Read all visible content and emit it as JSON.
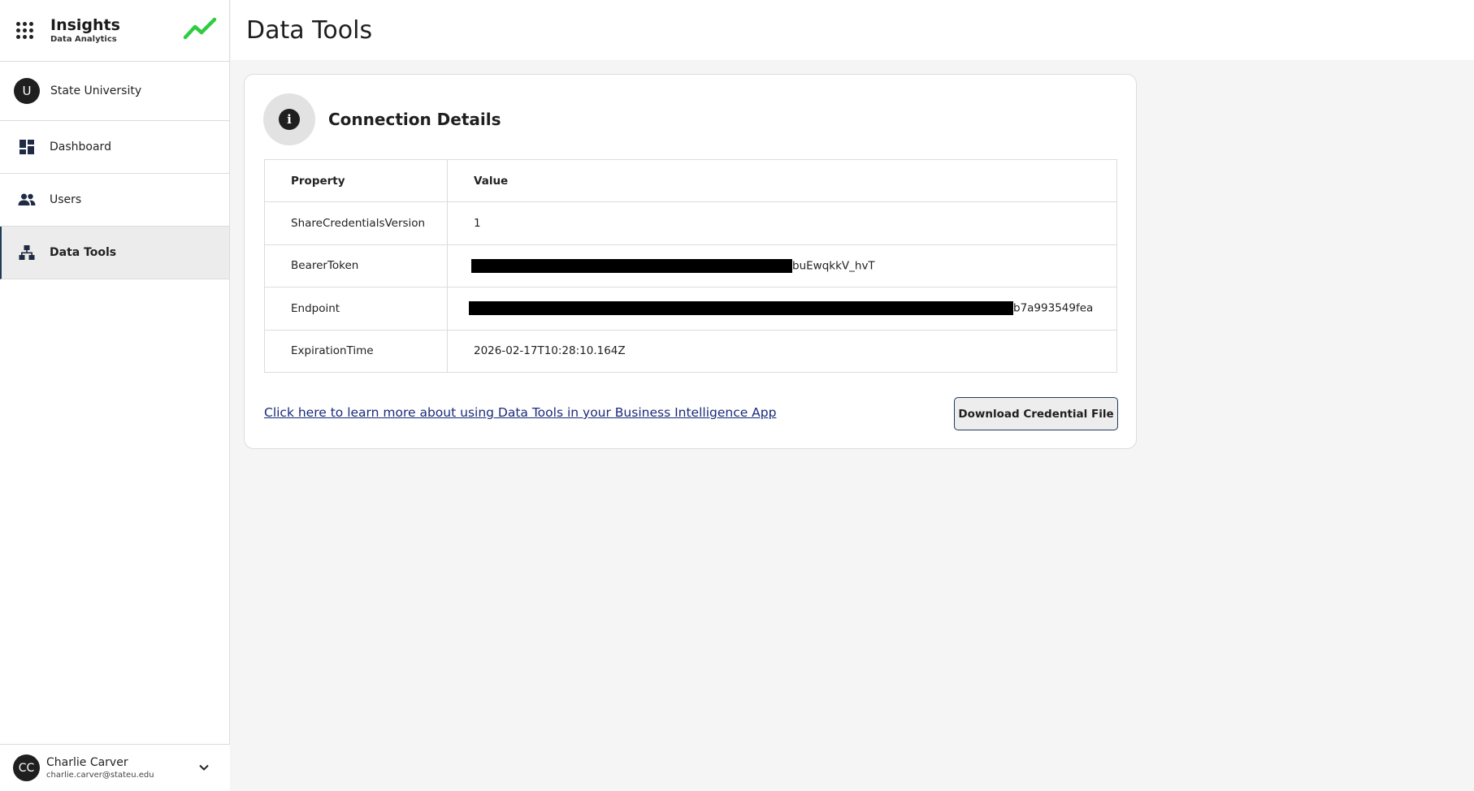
{
  "brand": {
    "title": "Insights",
    "subtitle": "Data Analytics"
  },
  "org": {
    "initial": "U",
    "name": "State University"
  },
  "nav": [
    {
      "label": "Dashboard",
      "icon": "dashboard-icon"
    },
    {
      "label": "Users",
      "icon": "users-icon"
    },
    {
      "label": "Data Tools",
      "icon": "hierarchy-icon",
      "active": true
    }
  ],
  "user": {
    "initials": "CC",
    "name": "Charlie Carver",
    "email": "charlie.carver@stateu.edu"
  },
  "page": {
    "title": "Data Tools"
  },
  "card": {
    "title": "Connection Details",
    "table": {
      "headers": [
        "Property",
        "Value"
      ],
      "rows": [
        {
          "property": "ShareCredentialsVersion",
          "value": "1"
        },
        {
          "property": "BearerToken",
          "value": "buEwqkkV_hvT",
          "redacted_prefix": true
        },
        {
          "property": "Endpoint",
          "value": "b7a993549fea",
          "redacted_prefix": true
        },
        {
          "property": "ExpirationTime",
          "value": "2026-02-17T10:28:10.164Z"
        }
      ]
    },
    "learn_link": "Click here to learn more about using Data Tools in your Business Intelligence App",
    "download_label": "Download Credential File"
  },
  "colors": {
    "accent": "#2ecc40",
    "active_border": "#1f3b57",
    "link": "#1a2a7a"
  }
}
